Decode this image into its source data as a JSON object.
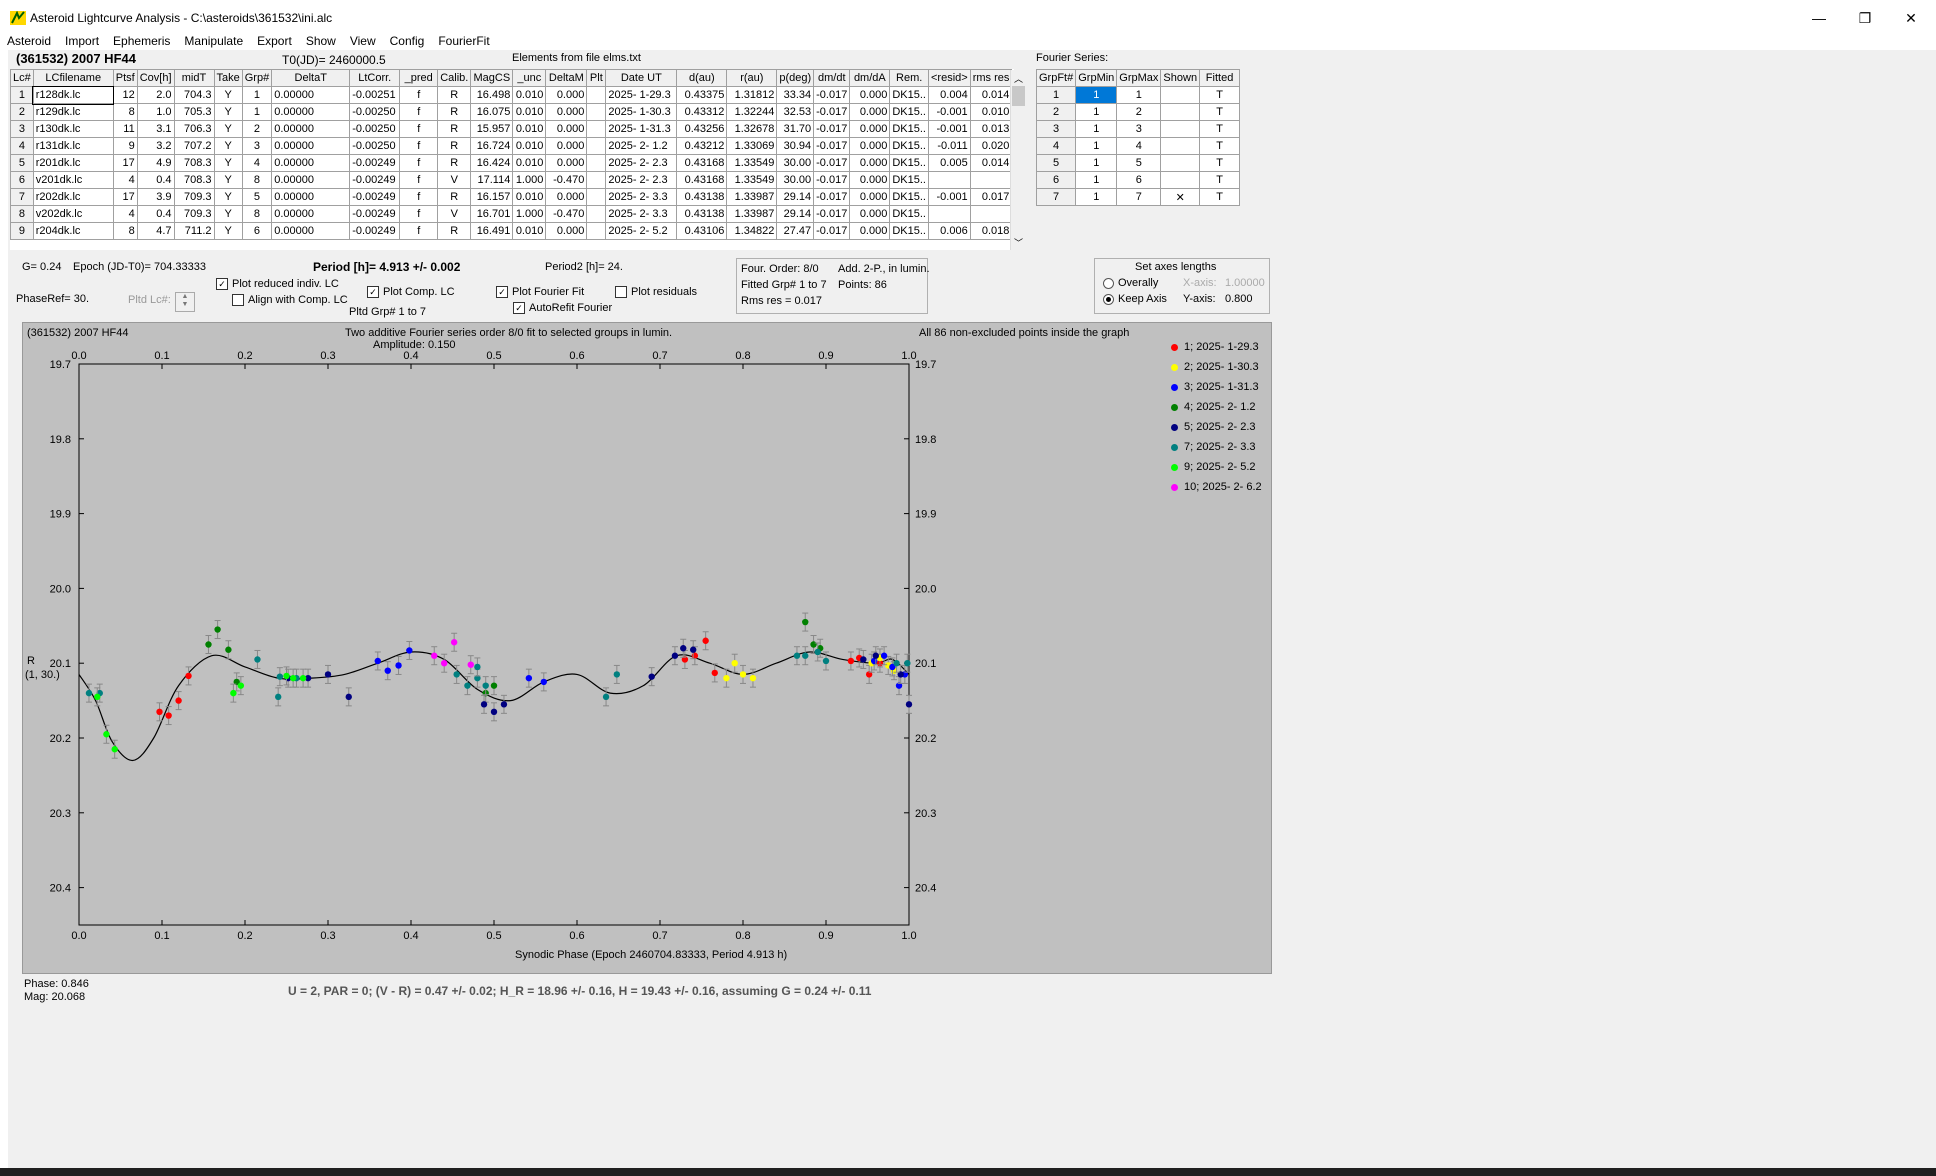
{
  "window": {
    "title": "Asteroid Lightcurve Analysis - C:\\asteroids\\361532\\ini.alc",
    "controls": {
      "minimize": "—",
      "restore": "❐",
      "close": "✕"
    }
  },
  "menu": [
    "Asteroid",
    "Import",
    "Ephemeris",
    "Manipulate",
    "Export",
    "Show",
    "View",
    "Config",
    "FourierFit"
  ],
  "header": {
    "asteroid_name": "(361532) 2007 HF44",
    "t0": "T0(JD)= 2460000.5",
    "elements": "Elements from file elms.txt",
    "fourier_series_label": "Fourier Series:"
  },
  "lc_table": {
    "columns": [
      "Lc#",
      "LCfilename",
      "Ptsf",
      "Cov[h]",
      "midT",
      "Take",
      "Grp#",
      "DeltaT",
      "LtCorr.",
      "_pred",
      "Calib.",
      "MagCS",
      "_unc",
      "DeltaM",
      "Plt",
      "Date UT",
      "d(au)",
      "r(au)",
      "p(deg)",
      "dm/dt",
      "dm/dA",
      "Rem.",
      "<resid>",
      "rms res"
    ],
    "rows": [
      [
        "1",
        "r128dk.lc",
        "12",
        "2.0",
        "704.3",
        "Y",
        "1",
        "0.00000",
        "-0.00251",
        "f",
        "R",
        "16.498",
        "0.010",
        "0.000",
        "",
        "2025- 1-29.3",
        "0.43375",
        "1.31812",
        "33.34",
        "-0.017",
        "0.000",
        "DK15..",
        "0.004",
        "0.014"
      ],
      [
        "2",
        "r129dk.lc",
        "8",
        "1.0",
        "705.3",
        "Y",
        "1",
        "0.00000",
        "-0.00250",
        "f",
        "R",
        "16.075",
        "0.010",
        "0.000",
        "",
        "2025- 1-30.3",
        "0.43312",
        "1.32244",
        "32.53",
        "-0.017",
        "0.000",
        "DK15..",
        "-0.001",
        "0.010"
      ],
      [
        "3",
        "r130dk.lc",
        "11",
        "3.1",
        "706.3",
        "Y",
        "2",
        "0.00000",
        "-0.00250",
        "f",
        "R",
        "15.957",
        "0.010",
        "0.000",
        "",
        "2025- 1-31.3",
        "0.43256",
        "1.32678",
        "31.70",
        "-0.017",
        "0.000",
        "DK15..",
        "-0.001",
        "0.013"
      ],
      [
        "4",
        "r131dk.lc",
        "9",
        "3.2",
        "707.2",
        "Y",
        "3",
        "0.00000",
        "-0.00250",
        "f",
        "R",
        "16.724",
        "0.010",
        "0.000",
        "",
        "2025- 2- 1.2",
        "0.43212",
        "1.33069",
        "30.94",
        "-0.017",
        "0.000",
        "DK15..",
        "-0.011",
        "0.020"
      ],
      [
        "5",
        "r201dk.lc",
        "17",
        "4.9",
        "708.3",
        "Y",
        "4",
        "0.00000",
        "-0.00249",
        "f",
        "R",
        "16.424",
        "0.010",
        "0.000",
        "",
        "2025- 2- 2.3",
        "0.43168",
        "1.33549",
        "30.00",
        "-0.017",
        "0.000",
        "DK15..",
        "0.005",
        "0.014"
      ],
      [
        "6",
        "v201dk.lc",
        "4",
        "0.4",
        "708.3",
        "Y",
        "8",
        "0.00000",
        "-0.00249",
        "f",
        "V",
        "17.114",
        "1.000",
        "-0.470",
        "",
        "2025- 2- 2.3",
        "0.43168",
        "1.33549",
        "30.00",
        "-0.017",
        "0.000",
        "DK15..",
        "",
        ""
      ],
      [
        "7",
        "r202dk.lc",
        "17",
        "3.9",
        "709.3",
        "Y",
        "5",
        "0.00000",
        "-0.00249",
        "f",
        "R",
        "16.157",
        "0.010",
        "0.000",
        "",
        "2025- 2- 3.3",
        "0.43138",
        "1.33987",
        "29.14",
        "-0.017",
        "0.000",
        "DK15..",
        "-0.001",
        "0.017"
      ],
      [
        "8",
        "v202dk.lc",
        "4",
        "0.4",
        "709.3",
        "Y",
        "8",
        "0.00000",
        "-0.00249",
        "f",
        "V",
        "16.701",
        "1.000",
        "-0.470",
        "",
        "2025- 2- 3.3",
        "0.43138",
        "1.33987",
        "29.14",
        "-0.017",
        "0.000",
        "DK15..",
        "",
        ""
      ],
      [
        "9",
        "r204dk.lc",
        "8",
        "4.7",
        "711.2",
        "Y",
        "6",
        "0.00000",
        "-0.00249",
        "f",
        "R",
        "16.491",
        "0.010",
        "0.000",
        "",
        "2025- 2- 5.2",
        "0.43106",
        "1.34822",
        "27.47",
        "-0.017",
        "0.000",
        "DK15..",
        "0.006",
        "0.018"
      ]
    ]
  },
  "fourier_table": {
    "columns": [
      "GrpFt#",
      "GrpMin",
      "GrpMax",
      "Shown",
      "Fitted"
    ],
    "rows": [
      [
        "1",
        "1",
        "1",
        "",
        "T"
      ],
      [
        "2",
        "1",
        "2",
        "",
        "T"
      ],
      [
        "3",
        "1",
        "3",
        "",
        "T"
      ],
      [
        "4",
        "1",
        "4",
        "",
        "T"
      ],
      [
        "5",
        "1",
        "5",
        "",
        "T"
      ],
      [
        "6",
        "1",
        "6",
        "",
        "T"
      ],
      [
        "7",
        "1",
        "7",
        "✕",
        "T"
      ]
    ]
  },
  "controls": {
    "g_value": "G= 0.24",
    "epoch": "Epoch (JD-T0)= 704.33333",
    "period": "Period [h]= 4.913 +/- 0.002",
    "period2": "Period2 [h]= 24.",
    "phaseref": "PhaseRef= 30.",
    "pltd_lc": "Pltd Lc#:",
    "plot_reduced": "Plot reduced indiv. LC",
    "align_comp": "Align with Comp. LC",
    "plot_comp": "Plot Comp. LC",
    "pltd_grp": "Pltd Grp#  1   to   7",
    "plot_fourier": "Plot Fourier Fit",
    "autorefit": "AutoRefit Fourier",
    "plot_residuals": "Plot residuals",
    "four_order": "Four. Order:  8/0",
    "add_2p": "Add. 2-P., in lumin.",
    "fitted_grp": "Fitted Grp# 1 to 7",
    "points": "Points: 86",
    "rms_res": "Rms res      = 0.017",
    "set_axes_title": "Set axes lengths",
    "overally": "Overally",
    "keep_axis": "Keep Axis",
    "x_axis_label": "X-axis:",
    "x_axis_value": "1.00000",
    "y_axis_label": "Y-axis:",
    "y_axis_value": "0.800"
  },
  "status": {
    "phase": "Phase:  0.846",
    "mag": "Mag:    20.068",
    "summary": "U = 2, PAR = 0; (V - R) = 0.47 +/- 0.02; H_R = 18.96 +/- 0.16, H = 19.43 +/- 0.16, assuming G = 0.24 +/- 0.11"
  },
  "chart_data": {
    "type": "scatter",
    "title_left": "(361532) 2007 HF44",
    "title_center": "Two additive Fourier series order 8/0 fit to selected groups in lumin.",
    "amplitude": "Amplitude: 0.150",
    "title_right": "All 86 non-excluded points inside the graph",
    "ylabel": "R",
    "ylabel2": "(1, 30.)",
    "xlabel": "Synodic Phase (Epoch 2460704.83333, Period 4.913 h)",
    "xlim": [
      0,
      1
    ],
    "ylim": [
      20.45,
      19.7
    ],
    "y_inverted": true,
    "x_ticks": [
      "0.0",
      "0.1",
      "0.2",
      "0.3",
      "0.4",
      "0.5",
      "0.6",
      "0.7",
      "0.8",
      "0.9",
      "1.0"
    ],
    "y_ticks": [
      "19.7",
      "19.8",
      "19.9",
      "20.0",
      "20.1",
      "20.2",
      "20.3",
      "20.4"
    ],
    "fourier_curve": [
      [
        0,
        20.115
      ],
      [
        0.02,
        20.15
      ],
      [
        0.04,
        20.205
      ],
      [
        0.065,
        20.23
      ],
      [
        0.09,
        20.2
      ],
      [
        0.12,
        20.13
      ],
      [
        0.16,
        20.09
      ],
      [
        0.2,
        20.105
      ],
      [
        0.24,
        20.12
      ],
      [
        0.28,
        20.12
      ],
      [
        0.32,
        20.115
      ],
      [
        0.36,
        20.1
      ],
      [
        0.4,
        20.085
      ],
      [
        0.44,
        20.095
      ],
      [
        0.48,
        20.135
      ],
      [
        0.52,
        20.15
      ],
      [
        0.56,
        20.125
      ],
      [
        0.6,
        20.115
      ],
      [
        0.64,
        20.14
      ],
      [
        0.68,
        20.13
      ],
      [
        0.72,
        20.09
      ],
      [
        0.76,
        20.1
      ],
      [
        0.8,
        20.115
      ],
      [
        0.84,
        20.1
      ],
      [
        0.88,
        20.085
      ],
      [
        0.92,
        20.095
      ],
      [
        0.96,
        20.1
      ],
      [
        0.98,
        20.095
      ],
      [
        1.0,
        20.115
      ]
    ],
    "series": [
      {
        "name": "1; 2025- 1-29.3",
        "color": "#ff0000",
        "points": [
          [
            0.097,
            20.165
          ],
          [
            0.108,
            20.17
          ],
          [
            0.12,
            20.15
          ],
          [
            0.132,
            20.117
          ],
          [
            0.73,
            20.095
          ],
          [
            0.742,
            20.09
          ],
          [
            0.755,
            20.07
          ],
          [
            0.766,
            20.113
          ],
          [
            0.93,
            20.097
          ],
          [
            0.94,
            20.093
          ],
          [
            0.952,
            20.115
          ],
          [
            0.965,
            20.1
          ]
        ]
      },
      {
        "name": "2; 2025- 1-30.3",
        "color": "#ffff00",
        "points": [
          [
            0.78,
            20.12
          ],
          [
            0.79,
            20.1
          ],
          [
            0.8,
            20.115
          ],
          [
            0.812,
            20.12
          ],
          [
            0.955,
            20.1
          ],
          [
            0.965,
            20.093
          ],
          [
            0.975,
            20.103
          ],
          [
            0.982,
            20.11
          ]
        ]
      },
      {
        "name": "3; 2025- 1-31.3",
        "color": "#0000ff",
        "points": [
          [
            0.36,
            20.097
          ],
          [
            0.372,
            20.11
          ],
          [
            0.385,
            20.103
          ],
          [
            0.398,
            20.083
          ],
          [
            0.56,
            20.125
          ],
          [
            0.542,
            20.12
          ],
          [
            0.958,
            20.097
          ],
          [
            0.97,
            20.09
          ],
          [
            0.98,
            20.105
          ],
          [
            0.988,
            20.13
          ],
          [
            0.995,
            20.115
          ]
        ]
      },
      {
        "name": "4; 2025- 2- 1.2",
        "color": "#008000",
        "points": [
          [
            0.156,
            20.075
          ],
          [
            0.167,
            20.055
          ],
          [
            0.18,
            20.082
          ],
          [
            0.19,
            20.125
          ],
          [
            0.49,
            20.14
          ],
          [
            0.5,
            20.13
          ],
          [
            0.875,
            20.045
          ],
          [
            0.885,
            20.075
          ],
          [
            0.893,
            20.08
          ]
        ]
      },
      {
        "name": "5; 2025- 2- 2.3",
        "color": "#000080",
        "points": [
          [
            0.252,
            20.12
          ],
          [
            0.276,
            20.12
          ],
          [
            0.3,
            20.115
          ],
          [
            0.325,
            20.145
          ],
          [
            0.488,
            20.155
          ],
          [
            0.5,
            20.165
          ],
          [
            0.512,
            20.155
          ],
          [
            0.69,
            20.118
          ],
          [
            0.718,
            20.09
          ],
          [
            0.728,
            20.08
          ],
          [
            0.74,
            20.082
          ],
          [
            0.945,
            20.095
          ],
          [
            0.96,
            20.09
          ],
          [
            0.99,
            20.115
          ],
          [
            1.0,
            20.155
          ]
        ]
      },
      {
        "name": "7; 2025- 2- 3.3",
        "color": "#008080",
        "points": [
          [
            0.012,
            20.14
          ],
          [
            0.025,
            20.14
          ],
          [
            0.215,
            20.095
          ],
          [
            0.242,
            20.118
          ],
          [
            0.24,
            20.145
          ],
          [
            0.262,
            20.12
          ],
          [
            0.455,
            20.115
          ],
          [
            0.468,
            20.13
          ],
          [
            0.48,
            20.12
          ],
          [
            0.48,
            20.105
          ],
          [
            0.49,
            20.13
          ],
          [
            0.635,
            20.145
          ],
          [
            0.648,
            20.115
          ],
          [
            0.865,
            20.09
          ],
          [
            0.875,
            20.09
          ],
          [
            0.89,
            20.085
          ],
          [
            0.9,
            20.097
          ],
          [
            0.985,
            20.1
          ],
          [
            0.998,
            20.1
          ]
        ]
      },
      {
        "name": "9; 2025- 2- 5.2",
        "color": "#00ff00",
        "points": [
          [
            0.022,
            20.145
          ],
          [
            0.033,
            20.195
          ],
          [
            0.043,
            20.215
          ],
          [
            0.186,
            20.14
          ],
          [
            0.195,
            20.13
          ],
          [
            0.258,
            20.12
          ],
          [
            0.25,
            20.117
          ],
          [
            0.27,
            20.12
          ]
        ]
      },
      {
        "name": "10; 2025- 2- 6.2",
        "color": "#ff00ff",
        "points": [
          [
            0.428,
            20.09
          ],
          [
            0.44,
            20.1
          ],
          [
            0.452,
            20.072
          ],
          [
            0.472,
            20.102
          ]
        ]
      }
    ]
  }
}
